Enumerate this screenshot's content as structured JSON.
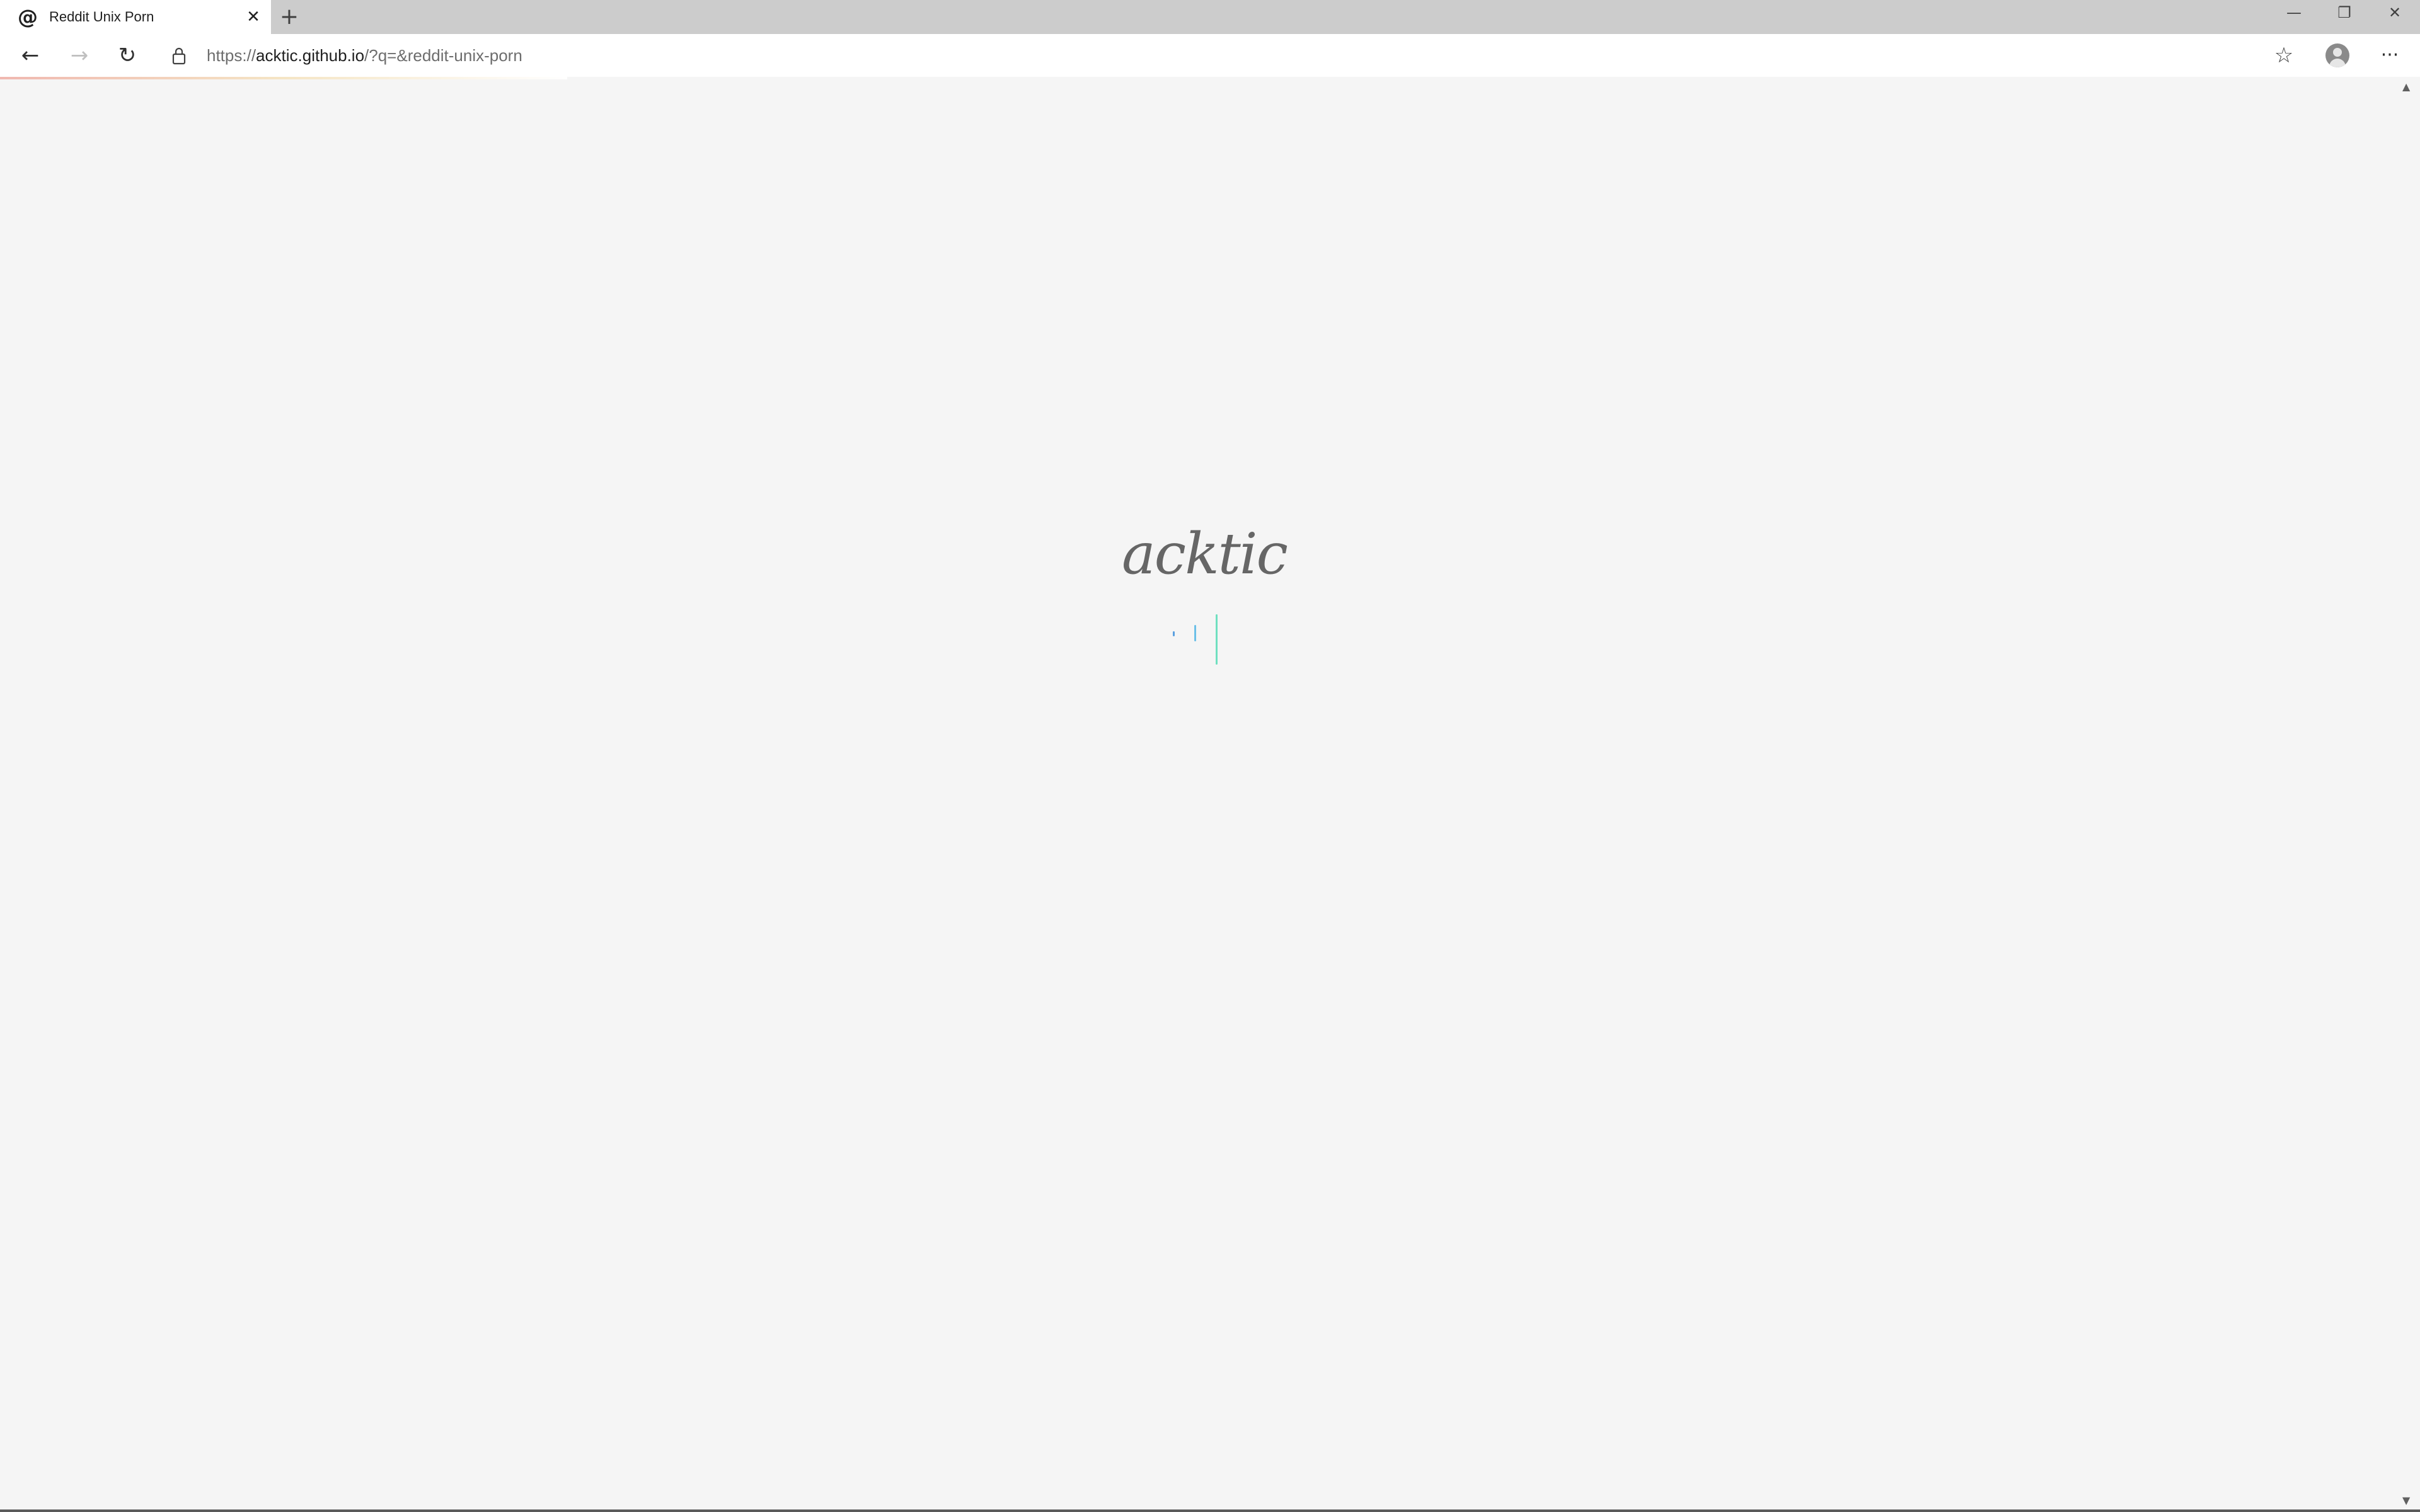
{
  "tab": {
    "title": "Reddit Unix Porn",
    "favicon_icon": "at-sign-icon",
    "close_icon": "close-icon",
    "new_tab_icon": "plus-icon"
  },
  "window_controls": {
    "minimize_icon": "minimize-icon",
    "restore_icon": "restore-icon",
    "close_icon": "close-icon"
  },
  "toolbar": {
    "back_icon": "back-arrow-icon",
    "forward_icon": "forward-arrow-icon",
    "refresh_icon": "refresh-icon",
    "lock_icon": "lock-icon",
    "url_scheme": "https://",
    "url_host": "acktic.github.io",
    "url_path": "/?q=&reddit-unix-porn",
    "favorite_icon": "star-icon",
    "profile_icon": "avatar-icon",
    "menu_icon": "more-icon"
  },
  "page": {
    "logo_text": "acktic",
    "spinner_colors": [
      "#5aa0e0",
      "#6cc0e8",
      "#6fe0c0"
    ]
  }
}
